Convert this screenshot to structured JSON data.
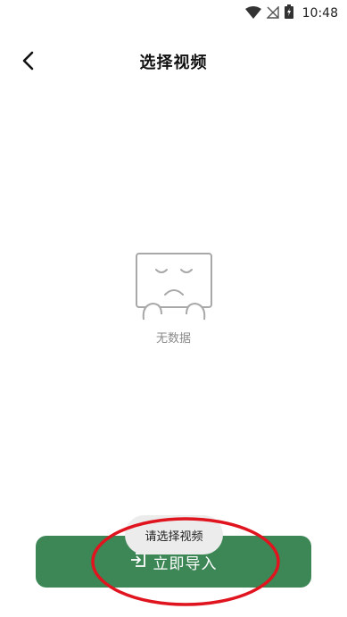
{
  "status_bar": {
    "time": "10:48",
    "icons": [
      "wifi-icon",
      "signal-off-icon",
      "battery-charging-icon"
    ]
  },
  "header": {
    "back_icon": "chevron-left-icon",
    "title": "选择视频"
  },
  "empty_state": {
    "icon": "sad-box-icon",
    "text": "无数据"
  },
  "toast": {
    "text": "请选择视频"
  },
  "import_button": {
    "icon": "import-icon",
    "label": "立即导入"
  },
  "colors": {
    "primary": "#3d8757",
    "annotation": "#e0141e",
    "toast_bg": "#ececec",
    "empty_gray": "#9a9a9a"
  }
}
